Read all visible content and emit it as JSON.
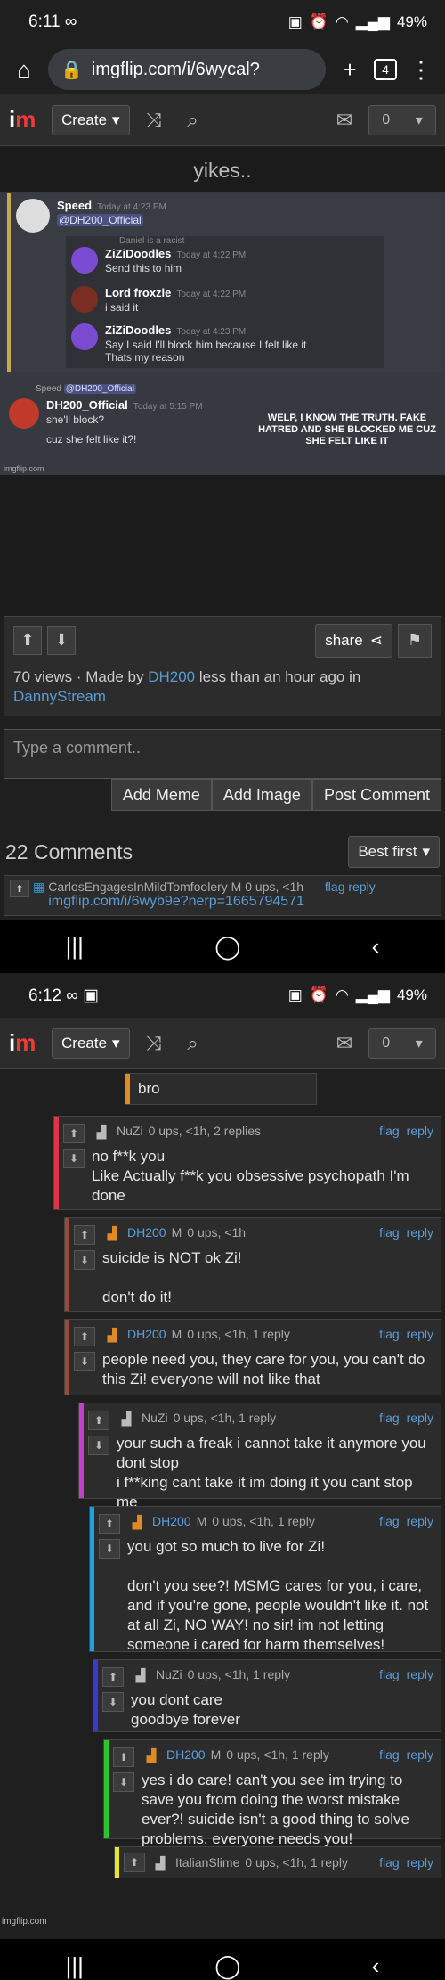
{
  "screen1": {
    "status": {
      "time": "6:11",
      "extra": "∞",
      "battery": "49%"
    },
    "url": "imgflip.com/i/6wycal?",
    "tabs_count": "4",
    "header": {
      "create_label": "Create",
      "notif_count": "0"
    },
    "meme": {
      "title": "yikes..",
      "top_msgs": [
        {
          "name": "Speed",
          "time": "Today at 4:23 PM",
          "text": "@DH200_Official"
        },
        {
          "name": "",
          "time": "",
          "text": "Daniel is a racist"
        },
        {
          "name": "ZiZiDoodles",
          "time": "Today at 4:22 PM",
          "text": "Send this to him"
        },
        {
          "name": "Lord froxzie",
          "time": "Today at 4:22 PM",
          "text": "i said it"
        },
        {
          "name": "ZiZiDoodles",
          "time": "Today at 4:23 PM",
          "text": "Say I said I'll block him because I felt like it\nThats my reason"
        }
      ],
      "reply_to": "Speed",
      "reply_mention": "@DH200_Official",
      "bottom_name": "DH200_Official",
      "bottom_time": "Today at 5:15 PM",
      "bottom_lines": [
        "she'll block?",
        "cuz she felt like it?!"
      ],
      "caption": "WELP, I KNOW THE TRUTH. FAKE HATRED AND SHE BLOCKED ME CUZ SHE FELT LIKE IT",
      "watermark": "imgflip.com"
    },
    "share_label": "share",
    "views": "70 views",
    "made_by_prefix": "Made by",
    "author": "DH200",
    "made_by_suffix": "less than an hour ago in",
    "stream": "DannyStream",
    "comment_placeholder": "Type a comment..",
    "actions": [
      "Add Meme",
      "Add Image",
      "Post Comment"
    ],
    "comments_title": "22 Comments",
    "sort_label": "Best first",
    "first_comment": {
      "user": "CarlosEngagesInMildTomfoolery",
      "badge": "M",
      "meta": "0 ups, <1h",
      "link": "imgflip.com/i/6wyb9e?nerp=1665794571"
    }
  },
  "screen2": {
    "status": {
      "time": "6:12",
      "extra": "∞ ▣",
      "battery": "49%"
    },
    "header": {
      "create_label": "Create",
      "notif_count": "0"
    },
    "comments": [
      {
        "user": "",
        "badge": "",
        "meta": "",
        "text": "bro",
        "color": "#e08a24"
      },
      {
        "user": "NuZi",
        "badge": "",
        "meta": "0 ups, <1h, 2 replies",
        "text": "no f**k you\nLike Actually f**k you obsessive psychopath I'm done",
        "color": "#e0334a"
      },
      {
        "user": "DH200",
        "badge": "M",
        "meta": "0 ups, <1h",
        "text": "suicide is NOT ok Zi!\n\ndon't do it!",
        "color": "#9a4a3a"
      },
      {
        "user": "DH200",
        "badge": "M",
        "meta": "0 ups, <1h, 1 reply",
        "text": "people need you, they care for you, you can't do this Zi! everyone will not like that",
        "color": "#9a4a3a"
      },
      {
        "user": "NuZi",
        "badge": "",
        "meta": "0 ups, <1h, 1 reply",
        "text": "your such a freak i cannot take it anymore you dont stop\ni f**king cant take it im doing it you cant stop me",
        "color": "#c23fc9"
      },
      {
        "user": "DH200",
        "badge": "M",
        "meta": "0 ups, <1h, 1 reply",
        "text": "you got so much to live for Zi!\n\ndon't you see?! MSMG cares for you, i care, and if you're gone, people wouldn't like it. not at all Zi, NO WAY! no sir! im not letting someone i cared for harm themselves!",
        "color": "#1fa0e0"
      },
      {
        "user": "NuZi",
        "badge": "",
        "meta": "0 ups, <1h, 1 reply",
        "text": "you dont care\ngoodbye forever",
        "color": "#3a3ad0"
      },
      {
        "user": "DH200",
        "badge": "M",
        "meta": "0 ups, <1h, 1 reply",
        "text": "yes i do care! can't you see im trying to save you from doing the worst mistake ever?! suicide isn't a good thing to solve problems. everyone needs you!",
        "color": "#2ec42e"
      },
      {
        "user": "ItalianSlime",
        "badge": "",
        "meta": "0 ups, <1h, 1 reply",
        "text": "",
        "color": "#e6e628"
      }
    ],
    "flag_label": "flag",
    "reply_label": "reply",
    "watermark": "imgflip.com"
  }
}
